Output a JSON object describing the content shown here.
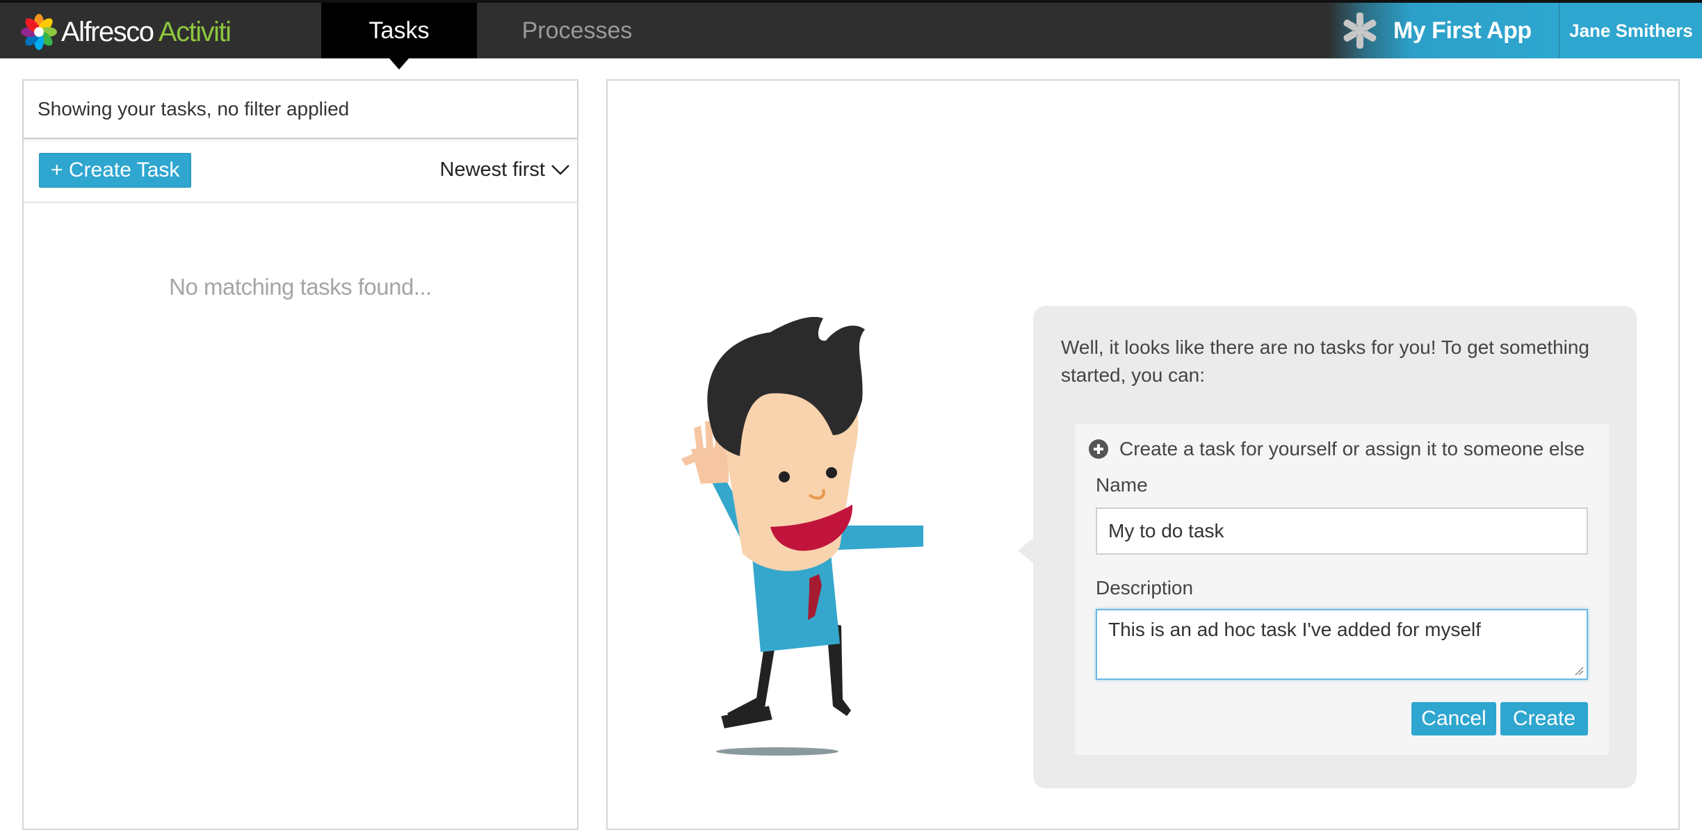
{
  "app": {
    "logo_part1": "Alfresco",
    "logo_part2": "Activiti",
    "tabs": [
      {
        "label": "Tasks",
        "active": true
      },
      {
        "label": "Processes",
        "active": false
      }
    ],
    "current_app": "My First App",
    "user": "Jane Smithers"
  },
  "task_list": {
    "filter_text": "Showing your tasks, no filter applied",
    "create_button": "+ Create Task",
    "sort_label": "Newest first",
    "empty_message": "No matching tasks found..."
  },
  "new_task": {
    "intro": "Well, it looks like there are no tasks for you! To get something started, you can:",
    "heading": "Create a task for yourself or assign it to someone else",
    "name_label": "Name",
    "name_value": "My to do task",
    "description_label": "Description",
    "description_value": "This is an ad hoc task I've added for myself",
    "cancel_button": "Cancel",
    "create_button": "Create"
  },
  "colors": {
    "topbar": "#2f2f2f",
    "accent": "#2ea6cf",
    "logo_green": "#8dc63f",
    "bubble": "#ebebeb"
  },
  "icons": [
    "alfresco-logo-icon",
    "app-asterisk-icon",
    "chevron-down-icon",
    "plus-circle-icon",
    "resize-handle-icon"
  ]
}
